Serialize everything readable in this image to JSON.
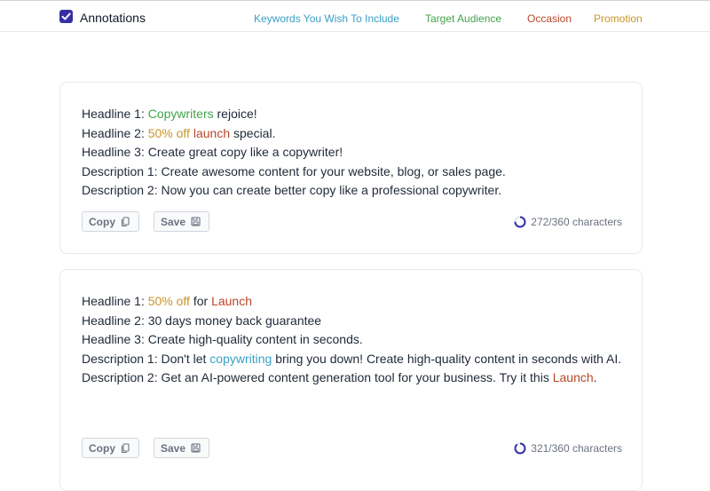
{
  "header": {
    "annotations_label": "Annotations",
    "annotations_checked": true,
    "legend": [
      {
        "label": "Keywords You Wish To Include",
        "color": "#3a9fc4"
      },
      {
        "label": "Target Audience",
        "color": "#42a34b"
      },
      {
        "label": "Occasion",
        "color": "#b7472a"
      },
      {
        "label": "Promotion",
        "color": "#c9962a"
      }
    ]
  },
  "cards": [
    {
      "lines": [
        [
          {
            "t": "Headline 1: "
          },
          {
            "t": "Copywriters",
            "c": "ta"
          },
          {
            "t": " rejoice!"
          }
        ],
        [
          {
            "t": "Headline 2: "
          },
          {
            "t": "50% off",
            "c": "pr"
          },
          {
            "t": " "
          },
          {
            "t": "launch",
            "c": "oc"
          },
          {
            "t": " special."
          }
        ],
        [
          {
            "t": "Headline 3: Create great copy like a copywriter!"
          }
        ],
        [
          {
            "t": "Description 1: Create awesome content for your website, blog, or sales page."
          }
        ],
        [
          {
            "t": "Description 2: Now you can create better copy like a professional copywriter."
          }
        ]
      ],
      "copy_label": "Copy",
      "save_label": "Save",
      "char_count": "272/360 characters",
      "char_progress": 0.756
    },
    {
      "lines": [
        [
          {
            "t": "Headline 1: "
          },
          {
            "t": "50% off",
            "c": "pr"
          },
          {
            "t": " for "
          },
          {
            "t": "Launch",
            "c": "oc"
          }
        ],
        [
          {
            "t": "Headline 2: 30 days money back guarantee"
          }
        ],
        [
          {
            "t": "Headline 3: Create high-quality content in seconds."
          }
        ],
        [
          {
            "t": "Description 1: Don't let "
          },
          {
            "t": "copywriting",
            "c": "kw"
          },
          {
            "t": " bring you down! Create high-quality content in seconds with AI."
          }
        ],
        [
          {
            "t": "Description 2: Get an AI-powered content generation tool for your business. Try it this "
          },
          {
            "t": "Launch",
            "c": "oc"
          },
          {
            "t": "."
          }
        ]
      ],
      "copy_label": "Copy",
      "save_label": "Save",
      "char_count": "321/360 characters",
      "char_progress": 0.892
    }
  ],
  "icons": {
    "checkbox": "check-icon",
    "copy": "copy-icon",
    "save": "save-icon",
    "progress": "progress-ring-icon"
  }
}
